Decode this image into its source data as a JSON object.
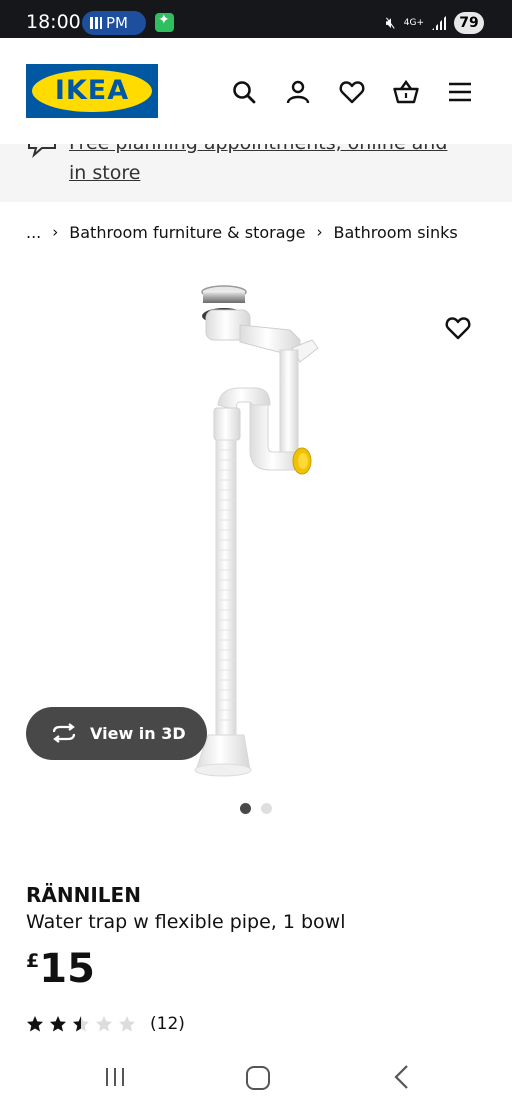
{
  "status_bar": {
    "time": "18:00",
    "call_pill": "PM",
    "network": "4G+",
    "battery": "79"
  },
  "header": {
    "logo_text": "IKEA",
    "icons": [
      "search-icon",
      "account-icon",
      "wishlist-heart-icon",
      "basket-icon",
      "menu-icon"
    ]
  },
  "banner": {
    "text": "Free planning appointments, online and in store"
  },
  "breadcrumb": {
    "ellipsis": "...",
    "items": [
      "Bathroom furniture & storage",
      "Bathroom sinks"
    ]
  },
  "gallery": {
    "view3d_label": "View in 3D",
    "dot_count": 2,
    "active_dot": 0
  },
  "product": {
    "name": "RÄNNILEN",
    "description": "Water trap w flexible pipe, 1 bowl",
    "currency": "£",
    "price": "15",
    "rating": 2.5,
    "rating_max": 5,
    "review_count": "(12)"
  },
  "colors": {
    "ikea_blue": "#0058a3",
    "ikea_yellow": "#ffdb00",
    "button_dark": "#484848"
  }
}
